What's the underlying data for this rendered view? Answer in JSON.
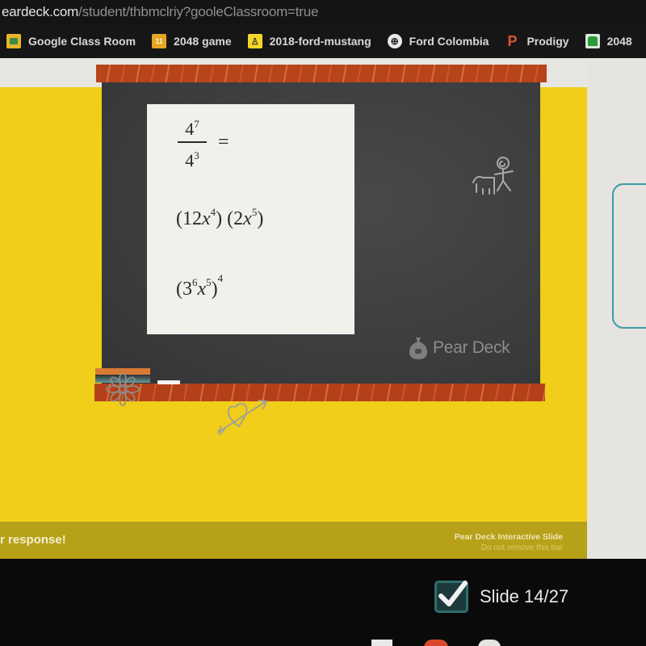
{
  "browser": {
    "url_host": "eardeck.com",
    "url_path": "/student/thbmclriy?gooleClassroom=true",
    "bookmarks": [
      {
        "label": "Google Class Room",
        "icon": "google-classroom-icon"
      },
      {
        "label": "2048 game",
        "icon": "2048-game-icon",
        "badge": "11"
      },
      {
        "label": "2018-ford-mustang",
        "icon": "ford-mustang-icon",
        "badge": "♙"
      },
      {
        "label": "Ford Colombia",
        "icon": "globe-icon",
        "badge": "⊕"
      },
      {
        "label": "Prodigy",
        "icon": "prodigy-icon",
        "badge": "P"
      },
      {
        "label": "2048",
        "icon": "tree-icon"
      },
      {
        "label": "",
        "icon": "tree-icon"
      }
    ]
  },
  "slide": {
    "equations": {
      "fraction": {
        "num_base": "4",
        "num_exp": "7",
        "den_base": "4",
        "den_exp": "3",
        "equals": "="
      },
      "product": {
        "open1": "(12",
        "var1": "x",
        "exp1": "4",
        "close1": ")",
        "open2": " (2",
        "var2": "x",
        "exp2": "5",
        "close2": ")"
      },
      "power": {
        "open": "(3",
        "coef_exp": "6",
        "var": "x",
        "var_exp": "5",
        "close": ")",
        "outer_exp": "4"
      }
    },
    "watermark": "Pear Deck",
    "bar_left_text": "r response!",
    "bar_right_title": "Pear Deck Interactive Slide",
    "bar_right_sub": "Do not remove this bar"
  },
  "status": {
    "slide_counter": "Slide 14/27",
    "checked": true
  },
  "colors": {
    "slide_yellow": "#f0ce19",
    "bar_olive": "#b6a118",
    "board": "#3a3b3c",
    "frame_wood": "#b8441c",
    "response_box_border": "#3d9aa6"
  }
}
